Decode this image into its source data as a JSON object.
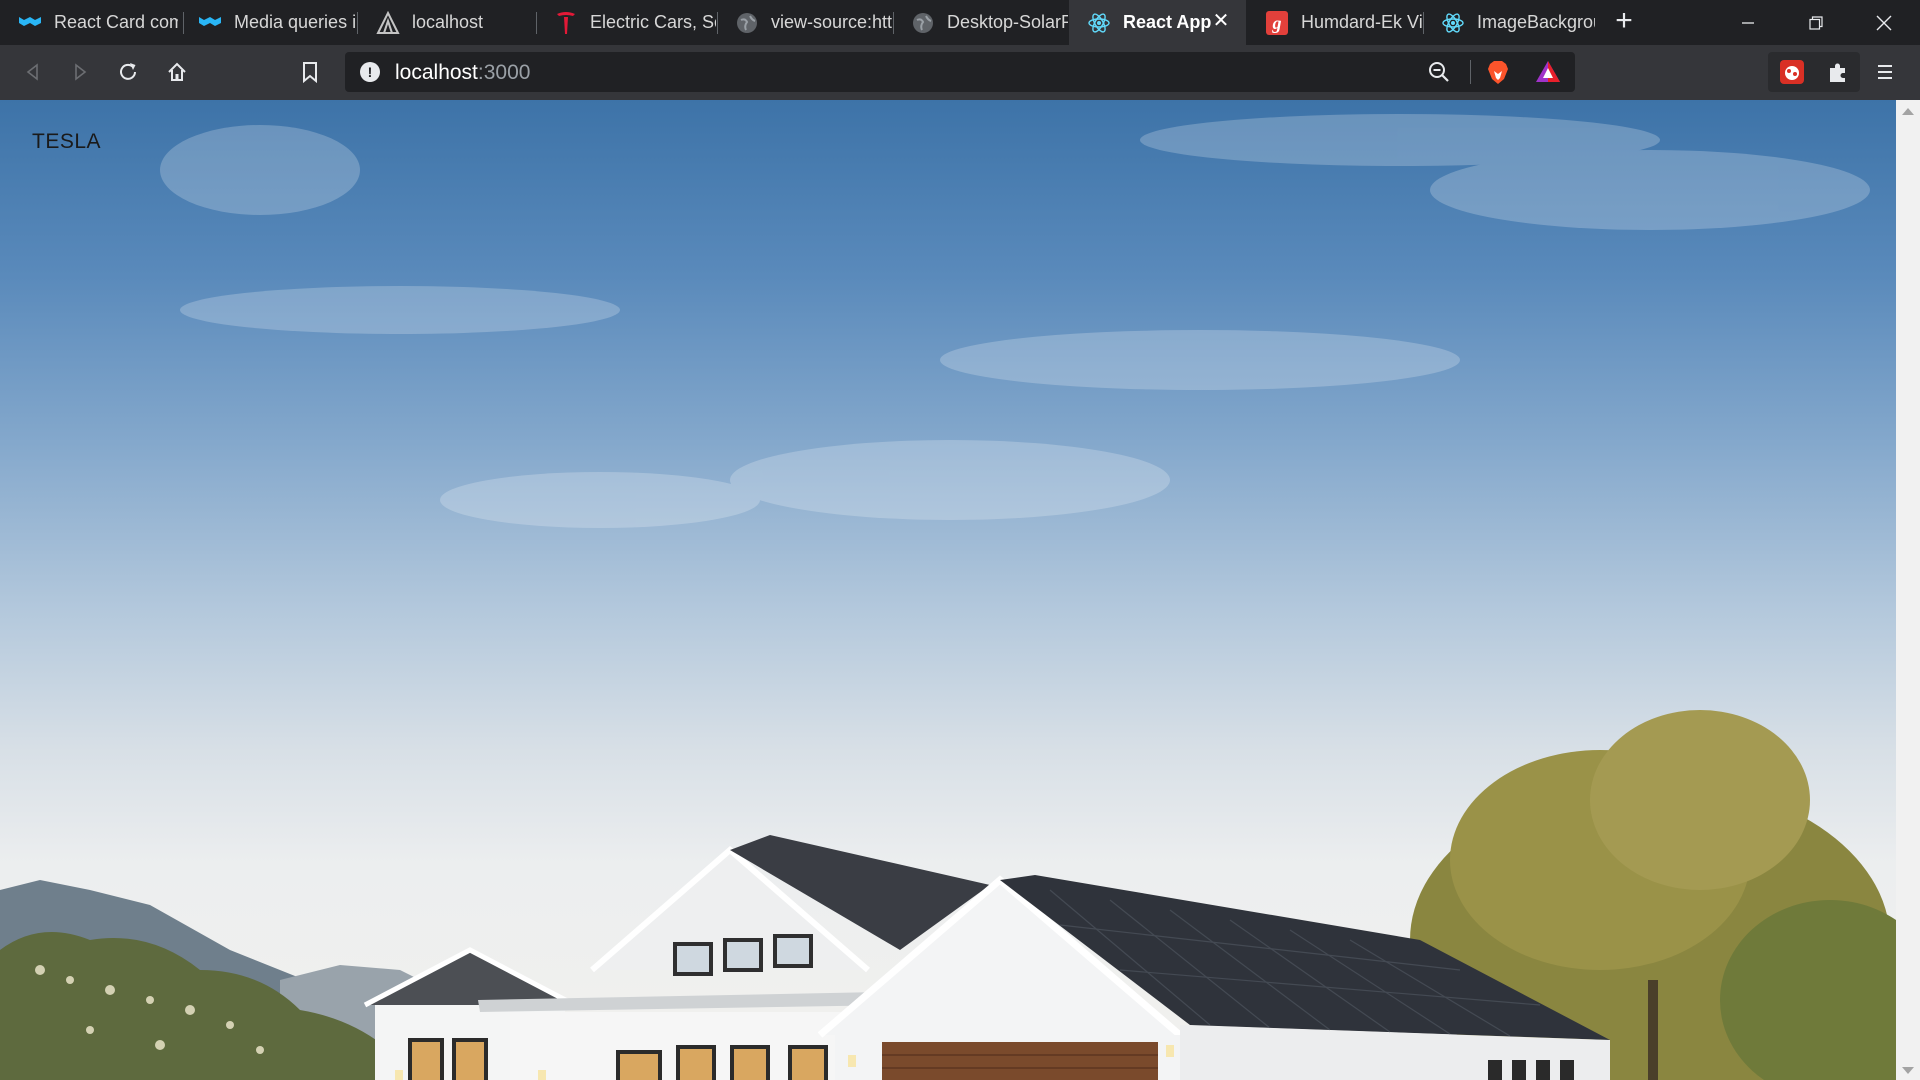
{
  "tabs": [
    {
      "label": "React Card com",
      "icon": "mui-icon"
    },
    {
      "label": "Media queries i",
      "icon": "mui-icon"
    },
    {
      "label": "localhost",
      "icon": "webpack-icon"
    },
    {
      "label": "Electric Cars, Sc",
      "icon": "tesla-icon"
    },
    {
      "label": "view-source:htt",
      "icon": "globe-icon"
    },
    {
      "label": "Desktop-SolarP",
      "icon": "globe-icon"
    },
    {
      "label": "React App",
      "icon": "react-icon",
      "active": true
    },
    {
      "label": "Humdard-Ek Vi",
      "icon": "g-icon"
    },
    {
      "label": "ImageBackgrou",
      "icon": "react-icon"
    }
  ],
  "address": {
    "host": "localhost",
    "path": ":3000"
  },
  "page": {
    "brand": "TESLA"
  },
  "colors": {
    "accent": "#8ab4f8",
    "tesla_red": "#e31937",
    "brave_orange": "#fb542b"
  }
}
